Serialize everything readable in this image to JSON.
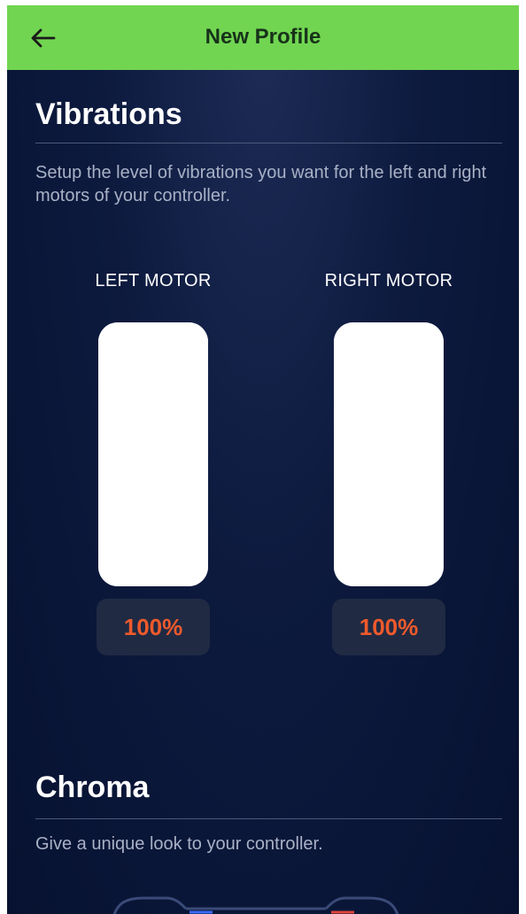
{
  "header": {
    "title": "New Profile",
    "back_icon": "arrow-left-icon",
    "background_color": "#71d551"
  },
  "vibrations": {
    "title": "Vibrations",
    "description": "Setup the level of vibrations you want for the left and right motors of your controller.",
    "left_motor": {
      "label": "LEFT MOTOR",
      "value_text": "100%",
      "level": 1.0
    },
    "right_motor": {
      "label": "RIGHT MOTOR",
      "value_text": "100%",
      "level": 1.0
    },
    "value_color": "#ee5a2c"
  },
  "chroma": {
    "title": "Chroma",
    "description": "Give a unique look to your controller."
  }
}
